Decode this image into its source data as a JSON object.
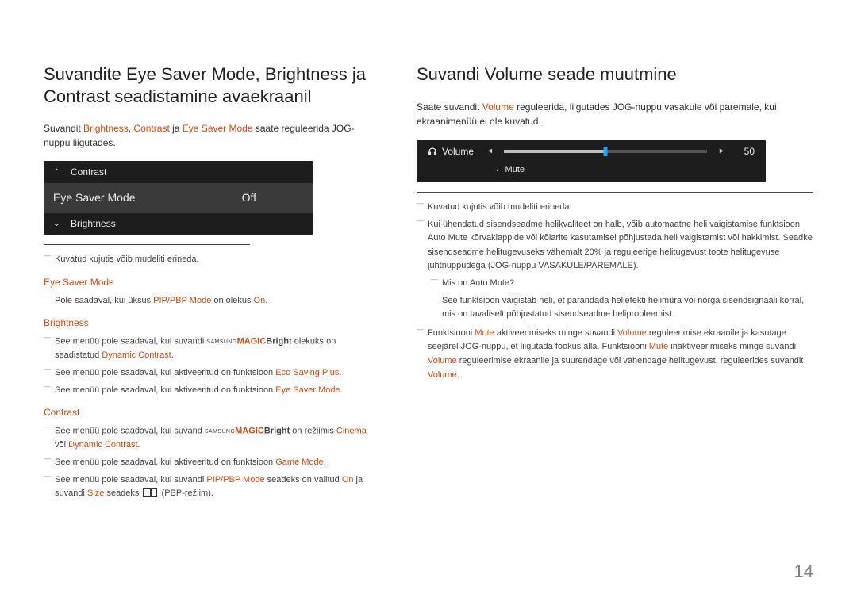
{
  "page_number": "14",
  "left": {
    "heading": "Suvandite Eye Saver Mode, Brightness ja Contrast seadistamine avaekraanil",
    "intro_before": "Suvandit ",
    "intro_hl1": "Brightness",
    "intro_sep1": ", ",
    "intro_hl2": "Contrast",
    "intro_sep2": " ja ",
    "intro_hl3": "Eye Saver Mode",
    "intro_after": " saate reguleerida JOG-nuppu liigutades.",
    "osd": {
      "contrast": "Contrast",
      "esm": "Eye Saver Mode",
      "esm_val": "Off",
      "brightness": "Brightness"
    },
    "note1": "Kuvatud kujutis võib mudeliti erineda.",
    "sub_esm": "Eye Saver Mode",
    "esm_b1_pre": "Pole saadaval, kui üksus ",
    "esm_b1_hl": "PIP/PBP Mode",
    "esm_b1_mid": " on olekus ",
    "esm_b1_on": "On",
    "esm_b1_end": ".",
    "sub_brightness": "Brightness",
    "br_b1_pre": "See menüü pole saadaval, kui suvandi ",
    "br_b1_magic_pre": "SAMSUNG",
    "br_b1_magic": "MAGIC",
    "br_b1_bright": "Bright",
    "br_b1_mid": " olekuks on seadistatud ",
    "br_b1_dc": "Dynamic Contrast",
    "br_b1_end": ".",
    "br_b2_pre": "See menüü pole saadaval, kui aktiveeritud on funktsioon ",
    "br_b2_hl": "Eco Saving Plus",
    "br_b2_end": ".",
    "br_b3_pre": "See menüü pole saadaval, kui aktiveeritud on funktsioon ",
    "br_b3_hl": "Eye Saver Mode",
    "br_b3_end": ".",
    "sub_contrast": "Contrast",
    "ct_b1_pre": "See menüü pole saadaval, kui suvand ",
    "ct_b1_magic_pre": "SAMSUNG",
    "ct_b1_magic": "MAGIC",
    "ct_b1_bright": "Bright",
    "ct_b1_mid": " on režiimis ",
    "ct_b1_cinema": "Cinema",
    "ct_b1_or": " või ",
    "ct_b1_dc": "Dynamic Contrast",
    "ct_b1_end": ".",
    "ct_b2_pre": "See menüü pole saadaval, kui aktiveeritud on funktsioon ",
    "ct_b2_hl": "Game Mode",
    "ct_b2_end": ".",
    "ct_b3_pre": "See menüü pole saadaval, kui suvandi ",
    "ct_b3_hl1": "PIP/PBP Mode",
    "ct_b3_mid1": " seadeks on valitud ",
    "ct_b3_on": "On",
    "ct_b3_mid2": " ja suvandi ",
    "ct_b3_size": "Size",
    "ct_b3_mid3": " seadeks ",
    "ct_b3_after": " (PBP-režiim)."
  },
  "right": {
    "heading": "Suvandi Volume seade muutmine",
    "intro_pre": "Saate suvandit ",
    "intro_hl": "Volume",
    "intro_after": " reguleerida, liigutades JOG-nuppu vasakule või paremale, kui ekraanimenüü ei ole kuvatud.",
    "osd": {
      "volume_label": "Volume",
      "mute_label": "Mute",
      "value": "50"
    },
    "note1": "Kuvatud kujutis võib mudeliti erineda.",
    "b2": "Kui ühendatud sisendseadme helikvaliteet on halb, võib automaatne heli vaigistamise funktsioon Auto Mute kõrvaklappide või kõlarite kasutamisel põhjustada heli vaigistamist või hakkimist. Seadke sisendseadme helitugevuseks vähemalt 20% ja reguleerige helitugevust toote helitugevuse juhtnuppudega (JOG-nuppu VASAKULE/PAREMALE).",
    "b2n_q": "Mis on Auto Mute?",
    "b2n_a": "See funktsioon vaigistab heli, et parandada heliefekti helimüra või nõrga sisendsignaali korral, mis on tavaliselt põhjustatud sisendseadme heliprobleemist.",
    "b3_pre": "Funktsiooni ",
    "b3_mute1": "Mute",
    "b3_mid1": " aktiveerimiseks minge suvandi ",
    "b3_vol1": "Volume",
    "b3_mid2": " reguleerimise ekraanile ja kasutage seejärel JOG-nuppu, et liigutada fookus alla. Funktsiooni ",
    "b3_mute2": "Mute",
    "b3_mid3": " inaktiveerimiseks minge suvandi ",
    "b3_vol2": "Volume",
    "b3_mid4": " reguleerimise ekraanile ja suurendage või vähendage helitugevust, reguleerides suvandit ",
    "b3_vol3": "Volume",
    "b3_end": "."
  }
}
